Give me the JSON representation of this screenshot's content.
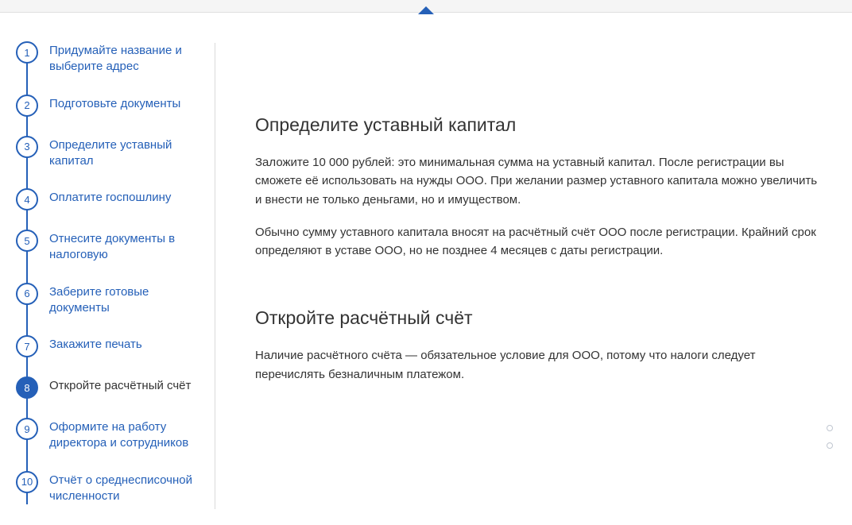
{
  "steps": [
    {
      "num": "1",
      "label": "Придумайте название и выберите адрес"
    },
    {
      "num": "2",
      "label": "Подготовьте документы"
    },
    {
      "num": "3",
      "label": "Определите уставный капитал"
    },
    {
      "num": "4",
      "label": "Оплатите госпошлину"
    },
    {
      "num": "5",
      "label": "Отнесите документы в налоговую"
    },
    {
      "num": "6",
      "label": "Заберите готовые документы"
    },
    {
      "num": "7",
      "label": "Закажите печать"
    },
    {
      "num": "8",
      "label": "Откройте расчётный счёт"
    },
    {
      "num": "9",
      "label": "Оформите на работу директора и сотрудников"
    },
    {
      "num": "10",
      "label": "Отчёт о среднесписочной численности"
    }
  ],
  "active_step_index": 7,
  "section1": {
    "title": "Определите уставный капитал",
    "p1": "Заложите 10 000 рублей: это минимальная сумма на уставный капитал. После регистрации вы сможете её использовать на нужды ООО. При желании размер уставного капитала можно увеличить и внести не только деньгами, но и имуществом.",
    "p2": "Обычно сумму уставного капитала вносят на расчётный счёт ООО после регистрации. Крайний срок определяют в уставе ООО, но не позднее 4 месяцев с даты регистрации."
  },
  "section2": {
    "title": "Откройте расчётный счёт",
    "p1": "Наличие расчётного счёта — обязательное условие для ООО, потому что налоги следует перечислять безналичным платежом."
  }
}
